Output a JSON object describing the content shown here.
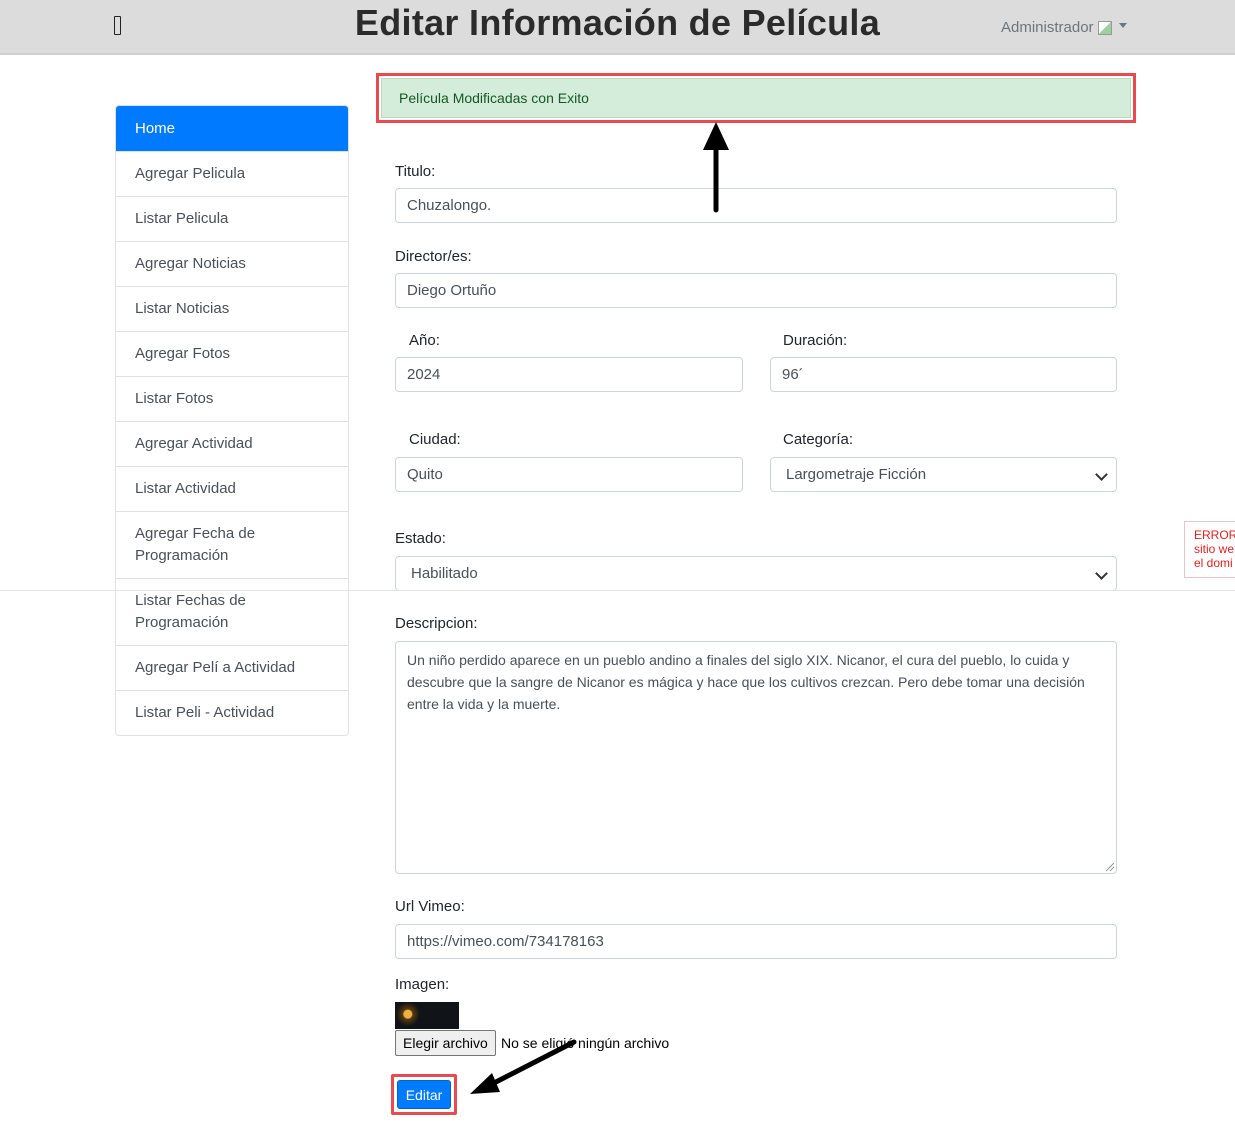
{
  "header": {
    "title": "Editar Información de Película",
    "user_label": "Administrador",
    "menu_icon": "hamburger-icon"
  },
  "sidebar": {
    "items": [
      {
        "label": "Home",
        "active": true
      },
      {
        "label": "Agregar Pelicula"
      },
      {
        "label": "Listar Pelicula"
      },
      {
        "label": "Agregar Noticias"
      },
      {
        "label": "Listar Noticias"
      },
      {
        "label": "Agregar Fotos"
      },
      {
        "label": "Listar Fotos"
      },
      {
        "label": "Agregar Actividad"
      },
      {
        "label": "Listar Actividad"
      },
      {
        "label": "Agregar Fecha de Programación"
      },
      {
        "label": "Listar Fechas de Programación"
      },
      {
        "label": "Agregar Pelí a Actividad"
      },
      {
        "label": "Listar Peli - Actividad"
      }
    ]
  },
  "alert": {
    "message": "Película Modificadas con Exito"
  },
  "form": {
    "titulo": {
      "label": "Titulo:",
      "value": "Chuzalongo."
    },
    "director": {
      "label": "Director/es:",
      "value": "Diego Ortuño"
    },
    "anio": {
      "label": "Año:",
      "value": "2024"
    },
    "duracion": {
      "label": "Duración:",
      "value": "96´"
    },
    "ciudad": {
      "label": "Ciudad:",
      "value": "Quito"
    },
    "categoria": {
      "label": "Categoría:",
      "value": "Largometraje Ficción"
    },
    "estado": {
      "label": "Estado:",
      "value": "Habilitado"
    },
    "descripcion": {
      "label": "Descripcion:",
      "value": "Un niño perdido aparece en un pueblo andino a finales del siglo XIX. Nicanor, el cura del pueblo, lo cuida y descubre que la sangre de Nicanor es mágica y hace que los cultivos crezcan. Pero debe tomar una decisión entre la vida y la muerte."
    },
    "url_vimeo": {
      "label": "Url Vimeo:",
      "value": "https://vimeo.com/734178163"
    },
    "imagen": {
      "label": "Imagen:",
      "choose_button": "Elegir archivo",
      "file_status": "No se eligió ningún archivo"
    },
    "submit_label": "Editar"
  },
  "error_notice": {
    "lines": [
      "ERROR",
      "sitio we",
      "el domi"
    ]
  },
  "colors": {
    "primary": "#007bff",
    "success_bg": "#d4edda",
    "highlight": "#e84a4f",
    "header_bg": "#dcdcdc"
  }
}
